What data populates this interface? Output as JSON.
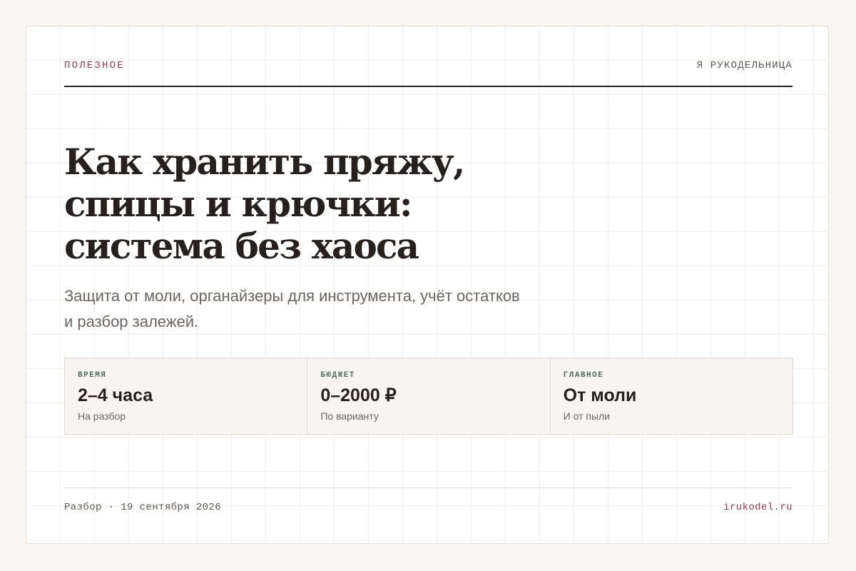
{
  "header": {
    "kicker": "ПОЛЕЗНОЕ",
    "brand": "Я РУКОДЕЛЬНИЦА"
  },
  "article": {
    "title": "Как хранить пряжу, спицы и крючки: система без хаоса",
    "subtitle": "Защита от моли, органайзеры для инструмента, учёт остатков и разбор залежей."
  },
  "stats": [
    {
      "label": "ВРЕМЯ",
      "value": "2–4 часа",
      "note": "На разбор"
    },
    {
      "label": "БЮДЖЕТ",
      "value": "0–2000 ₽",
      "note": "По варианту"
    },
    {
      "label": "ГЛАВНОЕ",
      "value": "От моли",
      "note": "И от пыли"
    }
  ],
  "footer": {
    "meta": "Разбор · 19 сентября 2026",
    "site": "irukodel.ru"
  },
  "colors": {
    "accent": "#9a3a4e",
    "label_green": "#4f6b55",
    "text": "#26211f",
    "muted": "#6b6461",
    "background": "#faf6f3"
  }
}
